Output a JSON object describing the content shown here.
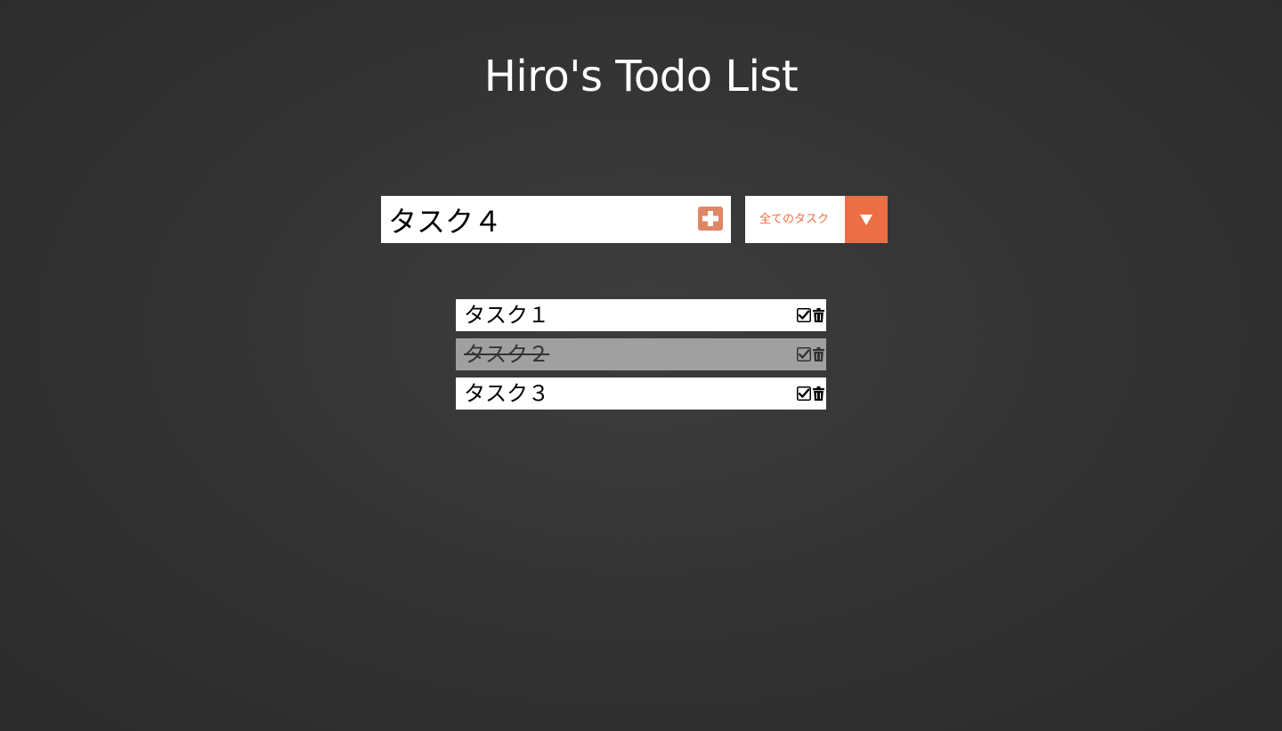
{
  "header": {
    "title": "Hiro's Todo List"
  },
  "new_task": {
    "value": "タスク４",
    "add_icon": "plus-square-icon"
  },
  "filter": {
    "selected": "全てのタスク",
    "arrow_icon": "triangle-down-icon"
  },
  "todos": [
    {
      "text": "タスク１",
      "done": false
    },
    {
      "text": "タスク２",
      "done": true
    },
    {
      "text": "タスク３",
      "done": false
    }
  ],
  "icons": {
    "complete": "check-square-icon",
    "delete": "trash-icon"
  },
  "colors": {
    "accent": "#ec6e44",
    "add_button": "#df8667",
    "done_row": "#a0a0a0",
    "background": "#353535"
  }
}
